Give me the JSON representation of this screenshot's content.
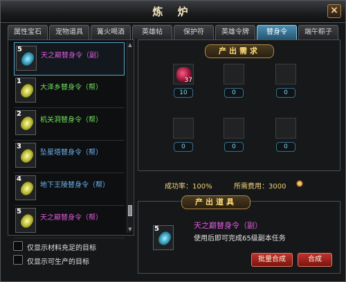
{
  "window": {
    "title": "炼 炉"
  },
  "tabs": [
    "属性宝石",
    "宠物道具",
    "篝火喝酒",
    "英雄帖",
    "保护符",
    "英雄令牌",
    "替身令",
    "端午粽子"
  ],
  "list": {
    "items": [
      {
        "level": "5",
        "name": "天之巅替身令（副）",
        "color": "#e05ae0"
      },
      {
        "level": "1",
        "name": "大泽乡替身令（帮）",
        "color": "#6fe05a"
      },
      {
        "level": "2",
        "name": "机关洞替身令（帮）",
        "color": "#6fe05a"
      },
      {
        "level": "3",
        "name": "坠星塔替身令（帮）",
        "color": "#6ab4f0"
      },
      {
        "level": "4",
        "name": "地下王陵替身令（帮）",
        "color": "#6ab4f0"
      },
      {
        "level": "5",
        "name": "天之巅替身令（帮）",
        "color": "#e05ae0"
      }
    ]
  },
  "filters": [
    "仅显示材料充足的目标",
    "仅显示可生产的目标"
  ],
  "requirements": {
    "title": "产出需求",
    "slots": [
      {
        "count": "10",
        "icon": "red-gem-icon",
        "qty": "37"
      },
      {
        "count": "0"
      },
      {
        "count": "0"
      },
      {
        "count": "0"
      },
      {
        "count": "0"
      },
      {
        "count": "0"
      }
    ]
  },
  "stats": {
    "success_rate": "成功率：100%",
    "cost": "所需费用：3000"
  },
  "output": {
    "title": "产出道具",
    "level": "5",
    "name": "天之巅替身令（副）",
    "desc": "使用后即可完成65级副本任务"
  },
  "buttons": {
    "batch": "批量合成",
    "craft": "合成"
  }
}
